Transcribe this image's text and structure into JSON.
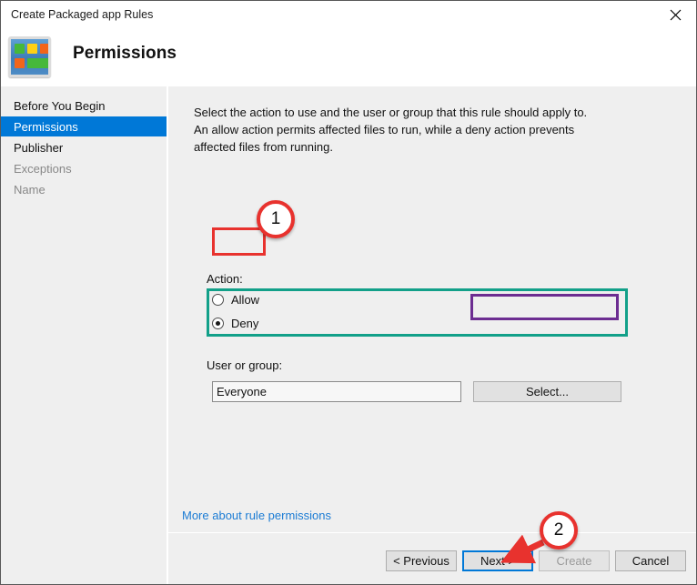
{
  "window": {
    "title": "Create Packaged app Rules",
    "close_icon": "close-icon"
  },
  "header": {
    "page_title": "Permissions",
    "app_icon": "packaged-app-icon"
  },
  "sidebar": {
    "items": [
      {
        "label": "Before You Begin",
        "state": "normal"
      },
      {
        "label": "Permissions",
        "state": "selected"
      },
      {
        "label": "Publisher",
        "state": "normal"
      },
      {
        "label": "Exceptions",
        "state": "disabled"
      },
      {
        "label": "Name",
        "state": "disabled"
      }
    ]
  },
  "main": {
    "description": "Select the action to use and the user or group that this rule should apply to. An allow action permits affected files to run, while a deny action prevents affected files from running.",
    "action": {
      "label": "Action:",
      "options": [
        {
          "label": "Allow",
          "checked": false
        },
        {
          "label": "Deny",
          "checked": true
        }
      ]
    },
    "user_or_group": {
      "label": "User or group:",
      "value": "Everyone",
      "select_button": "Select..."
    },
    "help_link": "More about rule permissions"
  },
  "footer": {
    "previous": "< Previous",
    "next": "Next >",
    "create": "Create",
    "cancel": "Cancel"
  },
  "annotations": {
    "callouts": [
      {
        "number": "1",
        "target": "deny-radio"
      },
      {
        "number": "2",
        "target": "next-button"
      }
    ],
    "colors": {
      "red": "#e8322e",
      "teal": "#12a089",
      "purple": "#6c2d91"
    }
  }
}
